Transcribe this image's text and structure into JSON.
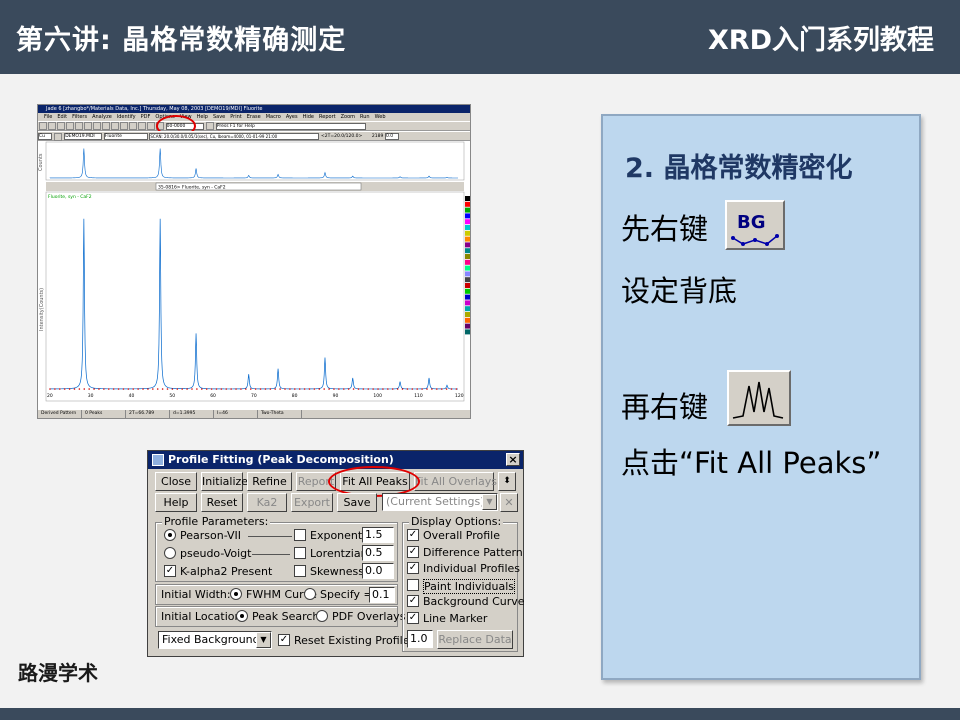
{
  "header": {
    "left_title": "第六讲: 晶格常数精确测定",
    "right_title": "XRD入门系列教程"
  },
  "footer": {
    "brand": "路漫学术"
  },
  "panel": {
    "title": "2. 晶格常数精密化",
    "line1": "先右键",
    "bg_button_label": "BG",
    "line2": "设定背底",
    "line3": "再右键",
    "line4": "点击“Fit All Peaks”"
  },
  "jade": {
    "title": "Jade 6 [zhangbo*/Materials Data, Inc.] Thursday, May 08, 2003 [DEMO19/MDI] Fluorite",
    "menu": [
      "File",
      "Edit",
      "Filters",
      "Analyze",
      "Identify",
      "PDF",
      "Options",
      "View",
      "Help",
      "Save",
      "Print",
      "Erase",
      "Macro",
      "Ayes",
      "Hide",
      "Report",
      "Zoom",
      "Run",
      "Web"
    ],
    "toolbar1": {
      "range": "00-0000",
      "hint": "Press F1 for Help"
    },
    "toolbar2": {
      "element": "Cu",
      "pattern": "DEMO19.MDI",
      "sample": "Fluorite",
      "scan": "SCAN: 20.0/30.0/0.05/1(sec), Cu, Ibeam=4000, 01-01-99 21:00",
      "range": "<2T=20.0/120.0>",
      "count": "2189",
      "val": "0.0"
    },
    "phase_select": "35-0816> Fluorite, syn - CaF2",
    "overlay_label": "Fluorite, syn - CaF2",
    "top_ylabel": "Counts",
    "main_ylabel": "Intensity(Counts)",
    "x_ticks": [
      "20",
      "30",
      "40",
      "50",
      "60",
      "70",
      "80",
      "90",
      "100",
      "110",
      "120"
    ],
    "status": [
      "Derived Pattern",
      "0 Peaks",
      "2T=66.789",
      "d=1.3995",
      "I=46",
      "Two-Theta"
    ]
  },
  "chart_data": {
    "type": "line",
    "title": "",
    "xlabel": "",
    "ylabel": "Intensity(Counts)",
    "xlim": [
      20,
      120
    ],
    "x_ticks": [
      20,
      30,
      40,
      50,
      60,
      70,
      80,
      90,
      100,
      110,
      120
    ],
    "peaks": [
      {
        "x": 28.3,
        "y": 0.92
      },
      {
        "x": 47.0,
        "y": 0.92
      },
      {
        "x": 55.8,
        "y": 0.3
      },
      {
        "x": 68.7,
        "y": 0.08
      },
      {
        "x": 75.9,
        "y": 0.11
      },
      {
        "x": 87.4,
        "y": 0.17
      },
      {
        "x": 94.2,
        "y": 0.06
      },
      {
        "x": 105.8,
        "y": 0.04
      },
      {
        "x": 112.9,
        "y": 0.06
      },
      {
        "x": 117.3,
        "y": 0.02
      }
    ],
    "series_color": "#0066cc"
  },
  "dialog": {
    "title": "Profile Fitting (Peak Decomposition)",
    "close_x": "×",
    "buttons_row1": [
      "Close",
      "Initialize",
      "Refine",
      "Report",
      "Fit All Peaks",
      "Fit All Overlays"
    ],
    "buttons_row2": [
      "Help",
      "Reset",
      "Ka2",
      "Export",
      "Save"
    ],
    "settings_select": "(Current Settings)",
    "profile_params_title": "Profile Parameters:",
    "pearson": "Pearson-VII",
    "pseudo_voigt": "pseudo-Voigt",
    "kalpha2": "K-alpha2 Present",
    "exponent_label": "Exponent =",
    "exponent_value": "1.5",
    "lorentzian_label": "Lorentzian =",
    "lorentzian_value": "0.5",
    "skewness_label": "Skewness =",
    "skewness_value": "0.0",
    "initial_width_label": "Initial Width:",
    "fwhm": "FWHM Curve",
    "specify": "Specify =",
    "specify_value": "0.1",
    "initial_location_label": "Initial Location:",
    "peak_search": "Peak Search",
    "pdf_overlays": "PDF Overlays",
    "background_select": "Fixed Background",
    "reset_profiles": "Reset Existing Profiles",
    "display_options_title": "Display Options:",
    "display_options": [
      {
        "label": "Overall Profile",
        "checked": true
      },
      {
        "label": "Difference Pattern",
        "checked": true
      },
      {
        "label": "Individual Profiles",
        "checked": true
      },
      {
        "label": "Paint Individuals",
        "checked": false
      },
      {
        "label": "Background Curve",
        "checked": true
      },
      {
        "label": "Line Marker",
        "checked": true
      }
    ],
    "replace_value": "1.0",
    "replace_button": "Replace Data"
  }
}
